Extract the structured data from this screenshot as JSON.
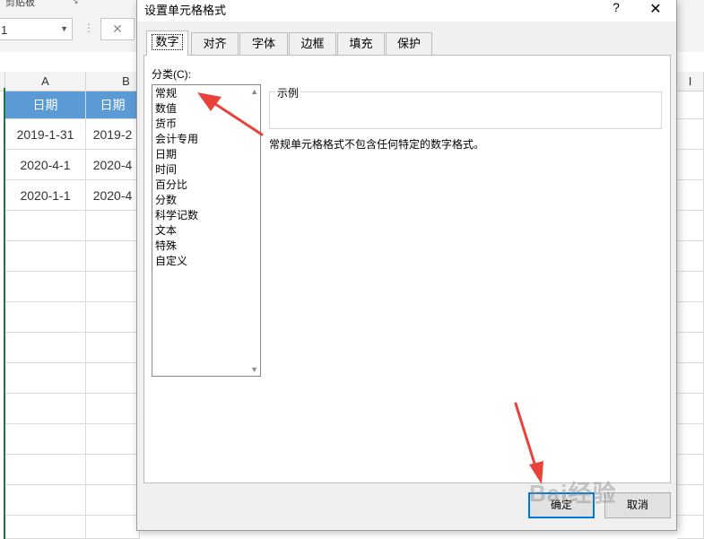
{
  "ribbon": {
    "group_label": "剪贴板",
    "launcher_icon": "dialog-launcher-icon"
  },
  "formula_bar": {
    "name_box_value": "1",
    "cancel_symbol": "✕",
    "separator": "⋮"
  },
  "sheet": {
    "columns": [
      "A",
      "B",
      "",
      "",
      "",
      "",
      "",
      "",
      "",
      "I"
    ],
    "header_row": [
      "日期",
      "日期"
    ],
    "rows": [
      [
        "2019-1-31",
        "2019-2"
      ],
      [
        "2020-4-1",
        "2020-4"
      ],
      [
        "2020-1-1",
        "2020-4"
      ]
    ]
  },
  "dialog": {
    "title": "设置单元格格式",
    "help_label": "?",
    "close_label": "✕",
    "tabs": [
      "数字",
      "对齐",
      "字体",
      "边框",
      "填充",
      "保护"
    ],
    "active_tab": "数字",
    "category_label": "分类(C):",
    "categories": [
      "常规",
      "数值",
      "货币",
      "会计专用",
      "日期",
      "时间",
      "百分比",
      "分数",
      "科学记数",
      "文本",
      "特殊",
      "自定义"
    ],
    "selected_category": "常规",
    "sample_label": "示例",
    "description": "常规单元格格式不包含任何特定的数字格式。",
    "ok_label": "确定",
    "cancel_label": "取消"
  },
  "watermark": "Bai经验",
  "colors": {
    "header_fill": "#5b9bd5",
    "arrow": "#e8423b",
    "selection": "#217346",
    "ok_border": "#0078d7"
  }
}
